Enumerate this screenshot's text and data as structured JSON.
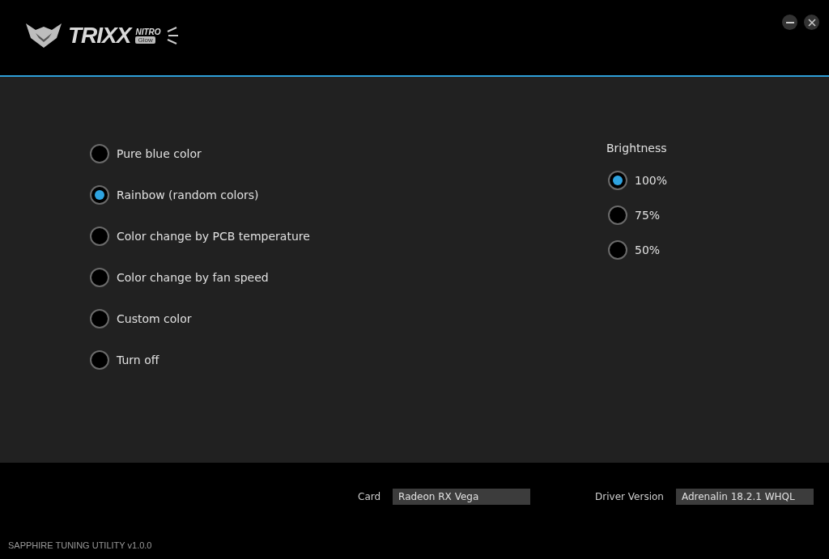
{
  "logo": {
    "brand": "TRIXX",
    "badge_top": "NITRO",
    "badge_bottom": "Glow"
  },
  "modes": [
    {
      "label": "Pure blue color",
      "selected": false
    },
    {
      "label": "Rainbow (random colors)",
      "selected": true
    },
    {
      "label": "Color change by PCB temperature",
      "selected": false
    },
    {
      "label": "Color change by fan speed",
      "selected": false
    },
    {
      "label": "Custom color",
      "selected": false
    },
    {
      "label": "Turn off",
      "selected": false
    }
  ],
  "brightness": {
    "title": "Brightness",
    "options": [
      {
        "label": "100%",
        "selected": true
      },
      {
        "label": "75%",
        "selected": false
      },
      {
        "label": "50%",
        "selected": false
      }
    ]
  },
  "footer": {
    "card_label": "Card",
    "card_value": "Radeon RX Vega",
    "driver_label": "Driver Version",
    "driver_value": "Adrenalin 18.2.1 WHQL",
    "app_version": "SAPPHIRE TUNING UTILITY v1.0.0"
  }
}
